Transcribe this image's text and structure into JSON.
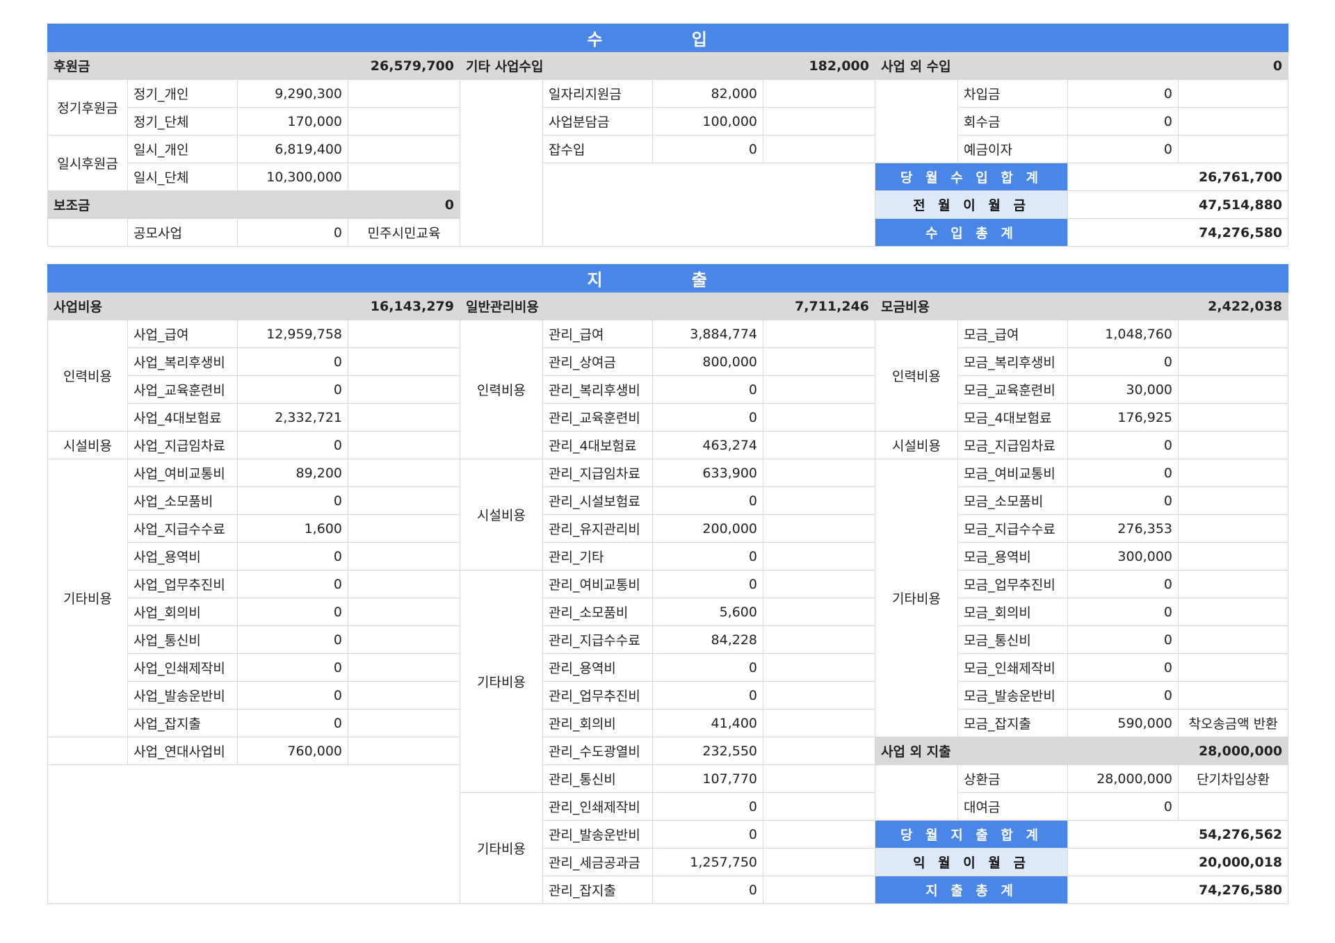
{
  "income": {
    "title": "수   입",
    "cat1": {
      "label": "후원금",
      "total": "26,579,700"
    },
    "cat2": {
      "label": "기타 사업수입",
      "total": "182,000"
    },
    "cat3": {
      "label": "사업 외 수입",
      "total": "0"
    },
    "g_regular": "정기후원금",
    "g_onetime": "일시후원금",
    "rows": [
      {
        "a": "정기_개인",
        "av": "9,290,300",
        "b": "일자리지원금",
        "bv": "82,000",
        "c": "차입금",
        "cv": "0"
      },
      {
        "a": "정기_단체",
        "av": "170,000",
        "b": "사업분담금",
        "bv": "100,000",
        "c": "회수금",
        "cv": "0"
      },
      {
        "a": "일시_개인",
        "av": "6,819,400",
        "b": "잡수입",
        "bv": "0",
        "c": "예금이자",
        "cv": "0"
      },
      {
        "a": "일시_단체",
        "av": "10,300,000"
      }
    ],
    "subsidy": {
      "label": "보조금",
      "total": "0",
      "item": "공모사업",
      "value": "0",
      "note": "민주시민교육"
    },
    "month_total": {
      "label": "당 월 수 입 합 계",
      "value": "26,761,700"
    },
    "carry_in": {
      "label": "전 월 이 월 금",
      "value": "47,514,880"
    },
    "grand_total": {
      "label": "수 입 총 계",
      "value": "74,276,580"
    }
  },
  "expense": {
    "title": "지   출",
    "cat1": {
      "label": "사업비용",
      "total": "16,143,279"
    },
    "cat2": {
      "label": "일반관리비용",
      "total": "7,711,246"
    },
    "cat3": {
      "label": "모금비용",
      "total": "2,422,038"
    },
    "g_labor": "인력비용",
    "g_facility": "시설비용",
    "g_other": "기타비용",
    "business": [
      {
        "name": "사업_급여",
        "value": "12,959,758"
      },
      {
        "name": "사업_복리후생비",
        "value": "0"
      },
      {
        "name": "사업_교육훈련비",
        "value": "0"
      },
      {
        "name": "사업_4대보험료",
        "value": "2,332,721"
      },
      {
        "name": "사업_지급임차료",
        "value": "0"
      },
      {
        "name": "사업_여비교통비",
        "value": "89,200"
      },
      {
        "name": "사업_소모품비",
        "value": "0"
      },
      {
        "name": "사업_지급수수료",
        "value": "1,600"
      },
      {
        "name": "사업_용역비",
        "value": "0"
      },
      {
        "name": "사업_업무추진비",
        "value": "0"
      },
      {
        "name": "사업_회의비",
        "value": "0"
      },
      {
        "name": "사업_통신비",
        "value": "0"
      },
      {
        "name": "사업_인쇄제작비",
        "value": "0"
      },
      {
        "name": "사업_발송운반비",
        "value": "0"
      },
      {
        "name": "사업_잡지출",
        "value": "0"
      },
      {
        "name": "사업_연대사업비",
        "value": "760,000"
      }
    ],
    "admin": [
      {
        "name": "관리_급여",
        "value": "3,884,774"
      },
      {
        "name": "관리_상여금",
        "value": "800,000"
      },
      {
        "name": "관리_복리후생비",
        "value": "0"
      },
      {
        "name": "관리_교육훈련비",
        "value": "0"
      },
      {
        "name": "관리_4대보험료",
        "value": "463,274"
      },
      {
        "name": "관리_지급임차료",
        "value": "633,900"
      },
      {
        "name": "관리_시설보험료",
        "value": "0"
      },
      {
        "name": "관리_유지관리비",
        "value": "200,000"
      },
      {
        "name": "관리_기타",
        "value": "0"
      },
      {
        "name": "관리_여비교통비",
        "value": "0"
      },
      {
        "name": "관리_소모품비",
        "value": "5,600"
      },
      {
        "name": "관리_지급수수료",
        "value": "84,228"
      },
      {
        "name": "관리_용역비",
        "value": "0"
      },
      {
        "name": "관리_업무추진비",
        "value": "0"
      },
      {
        "name": "관리_회의비",
        "value": "41,400"
      },
      {
        "name": "관리_수도광열비",
        "value": "232,550"
      },
      {
        "name": "관리_통신비",
        "value": "107,770"
      },
      {
        "name": "관리_인쇄제작비",
        "value": "0"
      },
      {
        "name": "관리_발송운반비",
        "value": "0"
      },
      {
        "name": "관리_세금공과금",
        "value": "1,257,750"
      },
      {
        "name": "관리_잡지출",
        "value": "0"
      }
    ],
    "fund": [
      {
        "name": "모금_급여",
        "value": "1,048,760",
        "note": ""
      },
      {
        "name": "모금_복리후생비",
        "value": "0",
        "note": ""
      },
      {
        "name": "모금_교육훈련비",
        "value": "30,000",
        "note": ""
      },
      {
        "name": "모금_4대보험료",
        "value": "176,925",
        "note": ""
      },
      {
        "name": "모금_지급임차료",
        "value": "0",
        "note": ""
      },
      {
        "name": "모금_여비교통비",
        "value": "0",
        "note": ""
      },
      {
        "name": "모금_소모품비",
        "value": "0",
        "note": ""
      },
      {
        "name": "모금_지급수수료",
        "value": "276,353",
        "note": ""
      },
      {
        "name": "모금_용역비",
        "value": "300,000",
        "note": ""
      },
      {
        "name": "모금_업무추진비",
        "value": "0",
        "note": ""
      },
      {
        "name": "모금_회의비",
        "value": "0",
        "note": ""
      },
      {
        "name": "모금_통신비",
        "value": "0",
        "note": ""
      },
      {
        "name": "모금_인쇄제작비",
        "value": "0",
        "note": ""
      },
      {
        "name": "모금_발송운반비",
        "value": "0",
        "note": ""
      },
      {
        "name": "모금_잡지출",
        "value": "590,000",
        "note": "착오송금액 반환"
      }
    ],
    "non_business": {
      "label": "사업 외 지출",
      "total": "28,000,000",
      "items": [
        {
          "name": "상환금",
          "value": "28,000,000",
          "note": "단기차입상환"
        },
        {
          "name": "대여금",
          "value": "0",
          "note": ""
        }
      ]
    },
    "month_total": {
      "label": "당 월 지 출 합 계",
      "value": "54,276,562"
    },
    "carry_out": {
      "label": "익 월 이 월 금",
      "value": "20,000,018"
    },
    "grand_total": {
      "label": "지 출 총 계",
      "value": "74,276,580"
    }
  }
}
